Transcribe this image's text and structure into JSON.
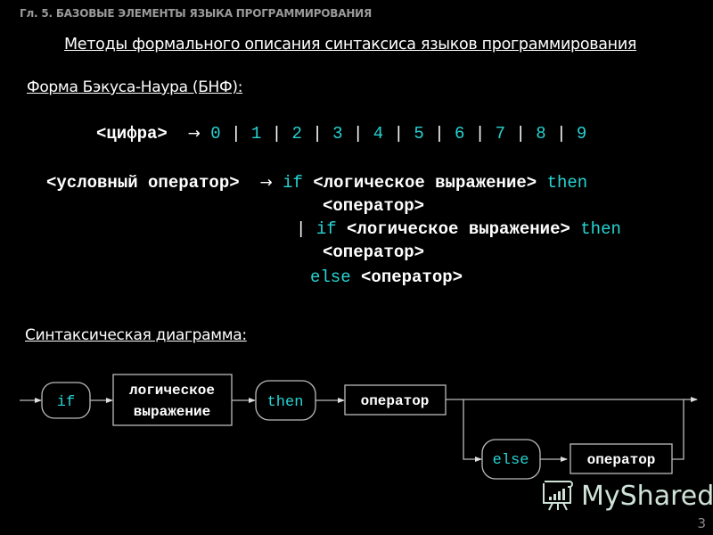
{
  "header": {
    "chapter": "Гл. 5. БАЗОВЫЕ ЭЛЕМЕНТЫ ЯЗЫКА ПРОГРАММИРОВАНИЯ",
    "title": "Методы формального описания синтаксиса языков программирования"
  },
  "bnf": {
    "heading": "Форма Бэкуса-Наура (БНФ):",
    "arrow": "→",
    "digit_rule": {
      "lhs": "<цифра>",
      "alternatives": [
        "0",
        "1",
        "2",
        "3",
        "4",
        "5",
        "6",
        "7",
        "8",
        "9"
      ],
      "separator": "|"
    },
    "cond_rule": {
      "lhs": "<условный оператор>",
      "if": "if",
      "then": "then",
      "else": "else",
      "sep": "|",
      "logic_expr": "<логическое выражение>",
      "operator": "<оператор>"
    }
  },
  "diagram": {
    "heading": "Синтаксическая диаграмма:",
    "nodes": {
      "if": "if",
      "logic_line1": "логическое",
      "logic_line2": "выражение",
      "then": "then",
      "operator1": "оператор",
      "else": "else",
      "operator2": "оператор"
    }
  },
  "watermark": {
    "text": "MyShared",
    "icon": "presentation-board-icon"
  },
  "page_number": "3",
  "colors": {
    "keyword": "#27d3d3",
    "background": "#000000",
    "text": "#ffffff"
  }
}
